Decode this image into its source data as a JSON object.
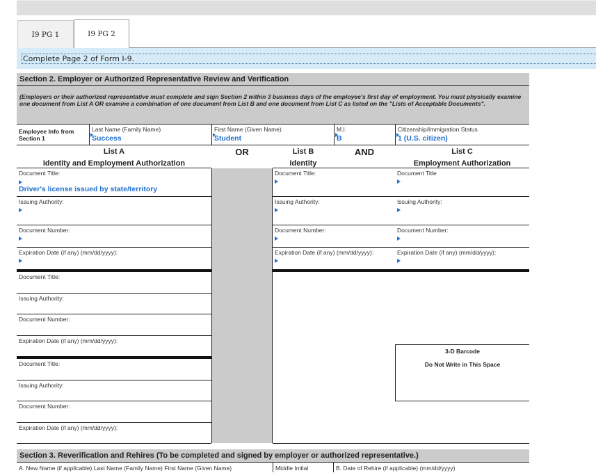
{
  "tabs": [
    {
      "label": "I9 PG 1",
      "active": false
    },
    {
      "label": "I9 PG 2",
      "active": true
    }
  ],
  "info_text": "Complete Page 2 of Form I-9.",
  "section2": {
    "title": "Section 2.  Employer or Authorized Representative Review and Verification",
    "note": "(Employers or their authorized representative must complete and sign Section 2 within 3 business days of the employee's first day of employment. You must physically examine one document from List A OR examine a combination of one document from List B and one document from List C as listed on the \"Lists of Acceptable Documents\".",
    "employee_info_label": "Employee Info from Section 1",
    "last_name": {
      "label": "Last Name (Family Name)",
      "value": "Success"
    },
    "first_name": {
      "label": "First Name (Given Name)",
      "value": "Student"
    },
    "mi": {
      "label": "M.I.",
      "value": "B"
    },
    "citizenship": {
      "label": "Citizenship/Immigration Status",
      "value": "1 (U.S. citizen)"
    }
  },
  "lists": {
    "list_a_title": "List A",
    "list_a_subtitle": "Identity and Employment Authorization",
    "or_label": "OR",
    "list_b_title": "List B",
    "list_b_subtitle": "Identity",
    "and_label": "AND",
    "list_c_title": "List C",
    "list_c_subtitle": "Employment Authorization"
  },
  "list_a": {
    "doc1": {
      "document_title_label": "Document Title:",
      "document_title_value": "Driver's license issued by state/territory",
      "issuing_authority_label": "Issuing Authority:",
      "document_number_label": "Document Number:",
      "expiration_label": "Expiration Date (if any) (mm/dd/yyyy):"
    },
    "doc2": {
      "document_title_label": "Document Title:",
      "issuing_authority_label": "Issuing Authority:",
      "document_number_label": "Document Number:",
      "expiration_label": "Expiration Date (if any) (mm/dd/yyyy):"
    },
    "doc3": {
      "document_title_label": "Document Title:",
      "issuing_authority_label": "Issuing Authority:",
      "document_number_label": "Document Number:",
      "expiration_label": "Expiration Date (if any) (mm/dd/yyyy):"
    }
  },
  "list_b": {
    "document_title_label": "Document Title:",
    "issuing_authority_label": "Issuing Authority:",
    "document_number_label": "Document Number:",
    "expiration_label": "Expiration Date (if any) (mm/dd/yyyy):"
  },
  "list_c": {
    "document_title_label": "Document Title",
    "issuing_authority_label": "Issuing Authority:",
    "document_number_label": "Document Number:",
    "expiration_label": "Expiration Date (if any) (mm/dd/yyyy):"
  },
  "barcode": {
    "title": "3-D Barcode",
    "subtitle": "Do Not Write in This Space"
  },
  "section3": {
    "title": "Section 3. Reverification and Rehires (To be completed and signed by employer or authorized representative.)",
    "new_name_label": "A. New Name (if applicable) Last Name (Family Name) First Name (Given Name)",
    "middle_initial_label": "Middle Initial",
    "rehire_date_label": "B. Date of Rehire (if applicable) (mm/dd/yyyy)"
  }
}
